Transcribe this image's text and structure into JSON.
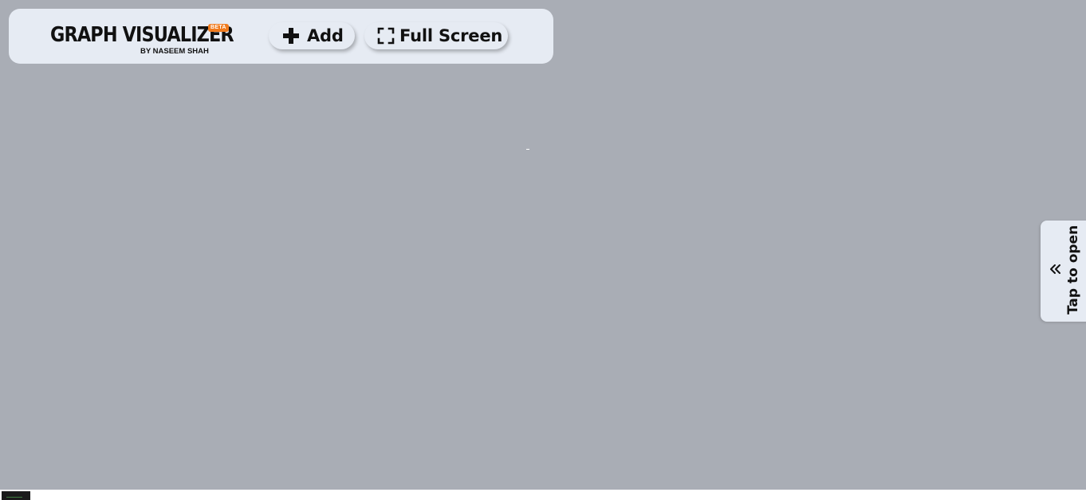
{
  "brand": {
    "title": "GRAPH VISUALIZER",
    "subtitle": "BY NASEEM SHAH",
    "badge": "BETA"
  },
  "toolbar": {
    "add_label": "Add",
    "add_icon": "plus-icon",
    "fullscreen_label": "Full Screen",
    "fullscreen_icon": "expand-icon"
  },
  "side_panel": {
    "label": "Tap to open",
    "icon": "double-chevron-left-icon"
  },
  "colors": {
    "canvas": "#a9adb5",
    "panel": "#e6ebf3",
    "badge": "#f07b1e",
    "text": "#111111"
  }
}
